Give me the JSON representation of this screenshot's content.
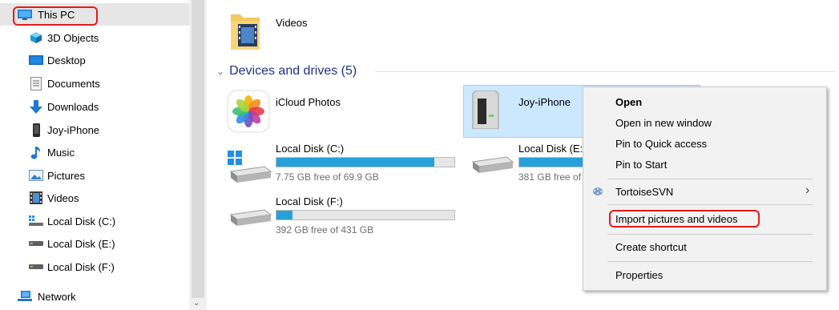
{
  "sidebar": {
    "items": [
      {
        "label": "This PC",
        "icon": "this-pc-icon"
      },
      {
        "label": "3D Objects",
        "icon": "3d-objects-icon"
      },
      {
        "label": "Desktop",
        "icon": "desktop-icon"
      },
      {
        "label": "Documents",
        "icon": "documents-icon"
      },
      {
        "label": "Downloads",
        "icon": "downloads-icon"
      },
      {
        "label": "Joy-iPhone",
        "icon": "iphone-icon"
      },
      {
        "label": "Music",
        "icon": "music-icon"
      },
      {
        "label": "Pictures",
        "icon": "pictures-icon"
      },
      {
        "label": "Videos",
        "icon": "videos-icon"
      },
      {
        "label": "Local Disk (C:)",
        "icon": "windows-drive-icon"
      },
      {
        "label": "Local Disk (E:)",
        "icon": "drive-icon"
      },
      {
        "label": "Local Disk (F:)",
        "icon": "drive-icon"
      },
      {
        "label": "Network",
        "icon": "network-icon"
      }
    ]
  },
  "content": {
    "folders": [
      {
        "label": "Videos",
        "icon": "videos-folder-icon"
      }
    ],
    "group_title": "Devices and drives (5)",
    "devices": [
      {
        "label": "iCloud Photos",
        "icon": "icloud-photos-icon"
      },
      {
        "label": "Joy-iPhone",
        "icon": "iphone-device-icon"
      }
    ],
    "drives": [
      {
        "label": "Local Disk (C:)",
        "free_text": "7.75 GB free of 69.9 GB",
        "used_fraction": 0.889
      },
      {
        "label": "Local Disk (E:)",
        "free_text": "381 GB free of 931 GB",
        "used_fraction": 0.59
      },
      {
        "label": "Local Disk (F:)",
        "free_text": "392 GB free of 431 GB",
        "used_fraction": 0.09
      }
    ]
  },
  "context_menu": {
    "items": [
      {
        "label": "Open",
        "bold": true
      },
      {
        "label": "Open in new window"
      },
      {
        "label": "Pin to Quick access"
      },
      {
        "label": "Pin to Start"
      },
      {
        "label": "TortoiseSVN",
        "submenu": true,
        "icon": "tortoisesvn-icon"
      },
      {
        "label": "Import pictures and videos",
        "highlighted": true
      },
      {
        "label": "Create shortcut"
      },
      {
        "label": "Properties"
      }
    ]
  },
  "colors": {
    "selection": "#cce8ff",
    "accent_bar": "#26a0da",
    "group_header": "#1e3287",
    "annotation": "#e31b1b"
  }
}
